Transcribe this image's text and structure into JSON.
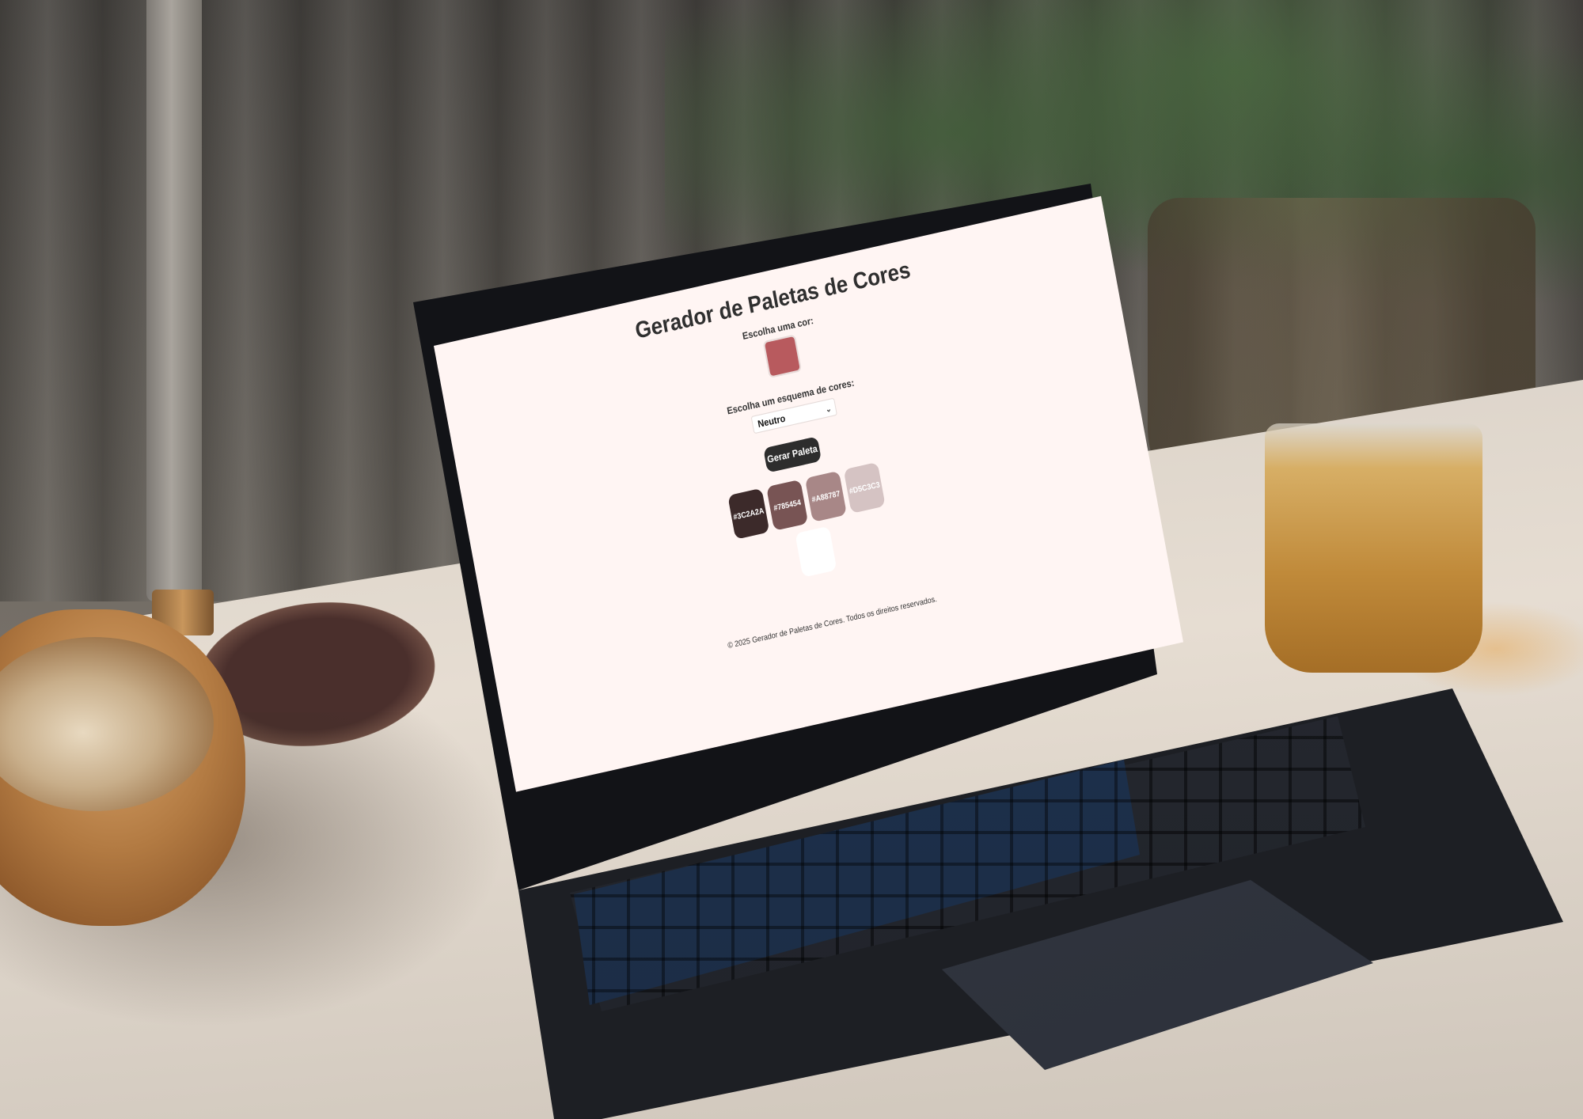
{
  "app": {
    "title": "Gerador de Paletas de Cores",
    "color_label": "Escolha uma cor:",
    "selected_color": "#b85a5e",
    "scheme_label": "Escolha um esquema de cores:",
    "scheme_value": "Neutro",
    "generate_button": "Gerar Paleta",
    "palette": [
      {
        "hex": "#3C2A2A",
        "color": "#3c2a2a"
      },
      {
        "hex": "#785454",
        "color": "#785454"
      },
      {
        "hex": "#A88787",
        "color": "#a88787"
      },
      {
        "hex": "#D5C3C3",
        "color": "#d5c3c3"
      },
      {
        "hex": "",
        "color": "#ffffff"
      }
    ],
    "footer": "© 2025 Gerador de Paletas de Cores. Todos os direitos reservados."
  },
  "colors": {
    "page_background": "#fff5f3",
    "button": "#2d2d2d"
  }
}
